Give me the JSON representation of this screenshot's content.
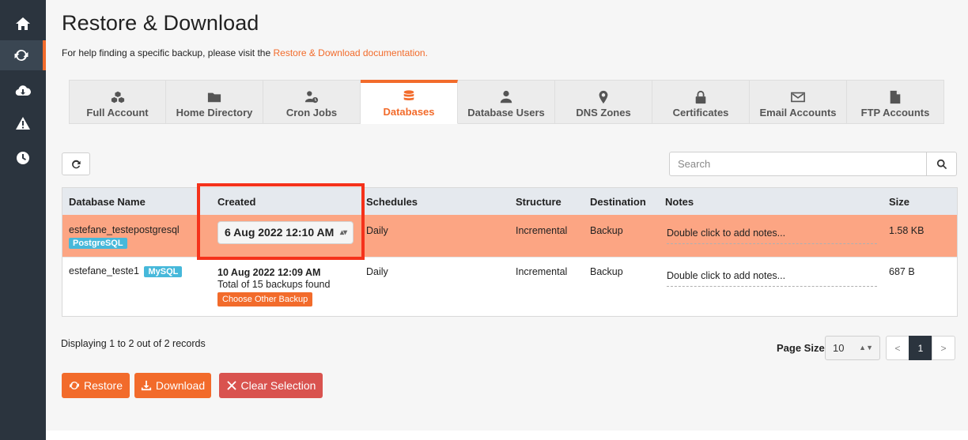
{
  "page": {
    "title": "Restore & Download",
    "help_prefix": "For help finding a specific backup, please visit the ",
    "help_link": "Restore & Download documentation."
  },
  "sidebar": {
    "items": [
      {
        "icon": "home-icon"
      },
      {
        "icon": "refresh-icon",
        "active": true
      },
      {
        "icon": "cloud-download-icon"
      },
      {
        "icon": "warning-icon"
      },
      {
        "icon": "clock-icon"
      }
    ]
  },
  "tabs": [
    {
      "label": "Full Account",
      "icon": "cubes-icon"
    },
    {
      "label": "Home Directory",
      "icon": "folder-icon"
    },
    {
      "label": "Cron Jobs",
      "icon": "user-clock-icon"
    },
    {
      "label": "Databases",
      "icon": "database-icon",
      "active": true
    },
    {
      "label": "Database Users",
      "icon": "user-icon"
    },
    {
      "label": "DNS Zones",
      "icon": "map-marker-icon"
    },
    {
      "label": "Certificates",
      "icon": "lock-icon"
    },
    {
      "label": "Email Accounts",
      "icon": "envelope-icon"
    },
    {
      "label": "FTP Accounts",
      "icon": "file-icon"
    }
  ],
  "search": {
    "placeholder": "Search"
  },
  "table": {
    "columns": [
      "Database Name",
      "Created",
      "Schedules",
      "Structure",
      "Destination",
      "Notes",
      "Size"
    ],
    "rows": [
      {
        "name": "estefane_testepostgresql",
        "type": "PostgreSQL",
        "created": "6 Aug 2022 12:10 AM",
        "schedules": "Daily",
        "structure": "Incremental",
        "destination": "Backup",
        "notes": "Double click to add notes...",
        "size": "1.58 KB"
      },
      {
        "name": "estefane_teste1",
        "type": "MySQL",
        "created": "10 Aug 2022 12:09 AM",
        "backups_found": "Total of 15 backups found",
        "choose_label": "Choose Other Backup",
        "schedules": "Daily",
        "structure": "Incremental",
        "destination": "Backup",
        "notes": "Double click to add notes...",
        "size": "687 B"
      }
    ]
  },
  "footer": {
    "display_text": "Displaying 1 to 2 out of 2 records",
    "page_size_label": "Page Size",
    "page_size_value": "10",
    "pager": {
      "prev": "<",
      "current": "1",
      "next": ">"
    }
  },
  "actions": {
    "restore": "Restore",
    "download": "Download",
    "clear": "Clear Selection"
  },
  "colors": {
    "accent": "#f26b2b",
    "sidebar": "#2b343e",
    "selected_row": "#fca583",
    "danger": "#d9534f",
    "badge": "#46b8da",
    "highlight": "#f5321b"
  }
}
